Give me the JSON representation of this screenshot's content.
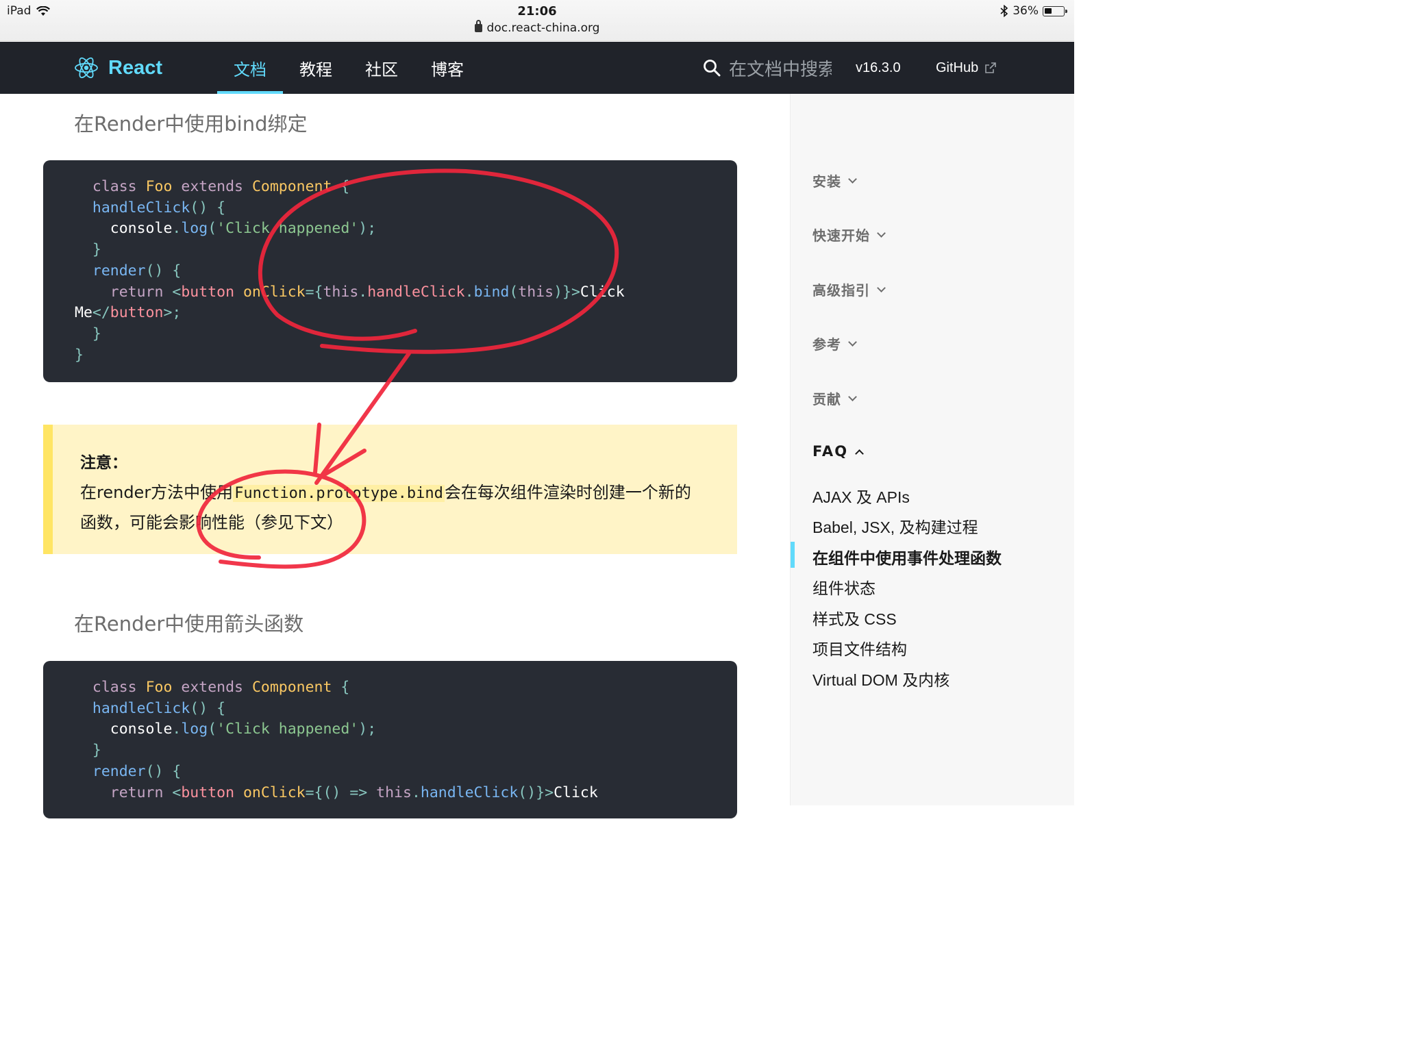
{
  "status_bar": {
    "device": "iPad",
    "time": "21:06",
    "url": "doc.react-china.org",
    "battery": "36%"
  },
  "header": {
    "brand": "React",
    "nav": [
      {
        "label": "文档",
        "active": true
      },
      {
        "label": "教程"
      },
      {
        "label": "社区"
      },
      {
        "label": "博客"
      }
    ],
    "search_placeholder": "在文档中搜索",
    "version": "v16.3.0",
    "github": "GitHub"
  },
  "content": {
    "heading_bind": "在Render中使用bind绑定",
    "code_bind": {
      "line1": {
        "k1": "class",
        "c1": "Foo",
        "k2": "extends",
        "c2": "Component",
        "p1": "{"
      },
      "line2": {
        "f1": "handleClick",
        "p1": "() {"
      },
      "line3": {
        "w1": "console",
        "p1": ".",
        "f1": "log",
        "p2": "(",
        "s1": "'Click happened'",
        "p3": ");"
      },
      "line4": {
        "p1": "}"
      },
      "line5": {
        "f1": "render",
        "p1": "() {"
      },
      "line6": {
        "k1": "return",
        "p1": "<",
        "t1": "button",
        "a1": "onClick",
        "p2": "={",
        "w1": "this",
        "p3": ".",
        "t2": "handleClick",
        "p4": ".",
        "f1": "bind",
        "p5": "(",
        "w2": "this",
        "p6": ")}>",
        "w3": "Click"
      },
      "line7": {
        "w1": "Me",
        "p1": "</",
        "t1": "button",
        "p2": ">;"
      },
      "line8": {
        "p1": "}"
      },
      "line9": {
        "p1": "}"
      }
    },
    "note": {
      "title": "注意：",
      "text_before": "在render方法中使用",
      "code": "Function.prototype.bind",
      "text_after": "会在每次组件渲染时创建一个新的函数，可能会影响性能（参见下文）"
    },
    "heading_arrow": "在Render中使用箭头函数",
    "code_arrow": {
      "line1": {
        "k1": "class",
        "c1": "Foo",
        "k2": "extends",
        "c2": "Component",
        "p1": "{"
      },
      "line2": {
        "f1": "handleClick",
        "p1": "() {"
      },
      "line3": {
        "w1": "console",
        "p1": ".",
        "f1": "log",
        "p2": "(",
        "s1": "'Click happened'",
        "p3": ");"
      },
      "line4": {
        "p1": "}"
      },
      "line5": {
        "f1": "render",
        "p1": "() {"
      },
      "line6": {
        "k1": "return",
        "p1": "<",
        "t1": "button",
        "a1": "onClick",
        "p2": "={() =>",
        "w1": "this",
        "p3": ".",
        "f1": "handleClick",
        "p4": "()}>",
        "w2": "Click"
      }
    }
  },
  "sidebar": {
    "sections": [
      {
        "label": "安装"
      },
      {
        "label": "快速开始"
      },
      {
        "label": "高级指引"
      },
      {
        "label": "参考"
      },
      {
        "label": "贡献"
      }
    ],
    "open_section": "FAQ",
    "links": [
      {
        "label": "AJAX 及 APIs"
      },
      {
        "label": "Babel, JSX, 及构建过程"
      },
      {
        "label": "在组件中使用事件处理函数",
        "active": true
      },
      {
        "label": "组件状态"
      },
      {
        "label": "样式及 CSS"
      },
      {
        "label": "项目文件结构"
      },
      {
        "label": "Virtual DOM 及内核"
      }
    ]
  },
  "colors": {
    "header_bg": "#20232a",
    "accent": "#61dafb",
    "code_bg": "#282c34",
    "note_bg": "#fff4c7",
    "note_border": "#ffe564",
    "annotation": "#f0263c"
  }
}
